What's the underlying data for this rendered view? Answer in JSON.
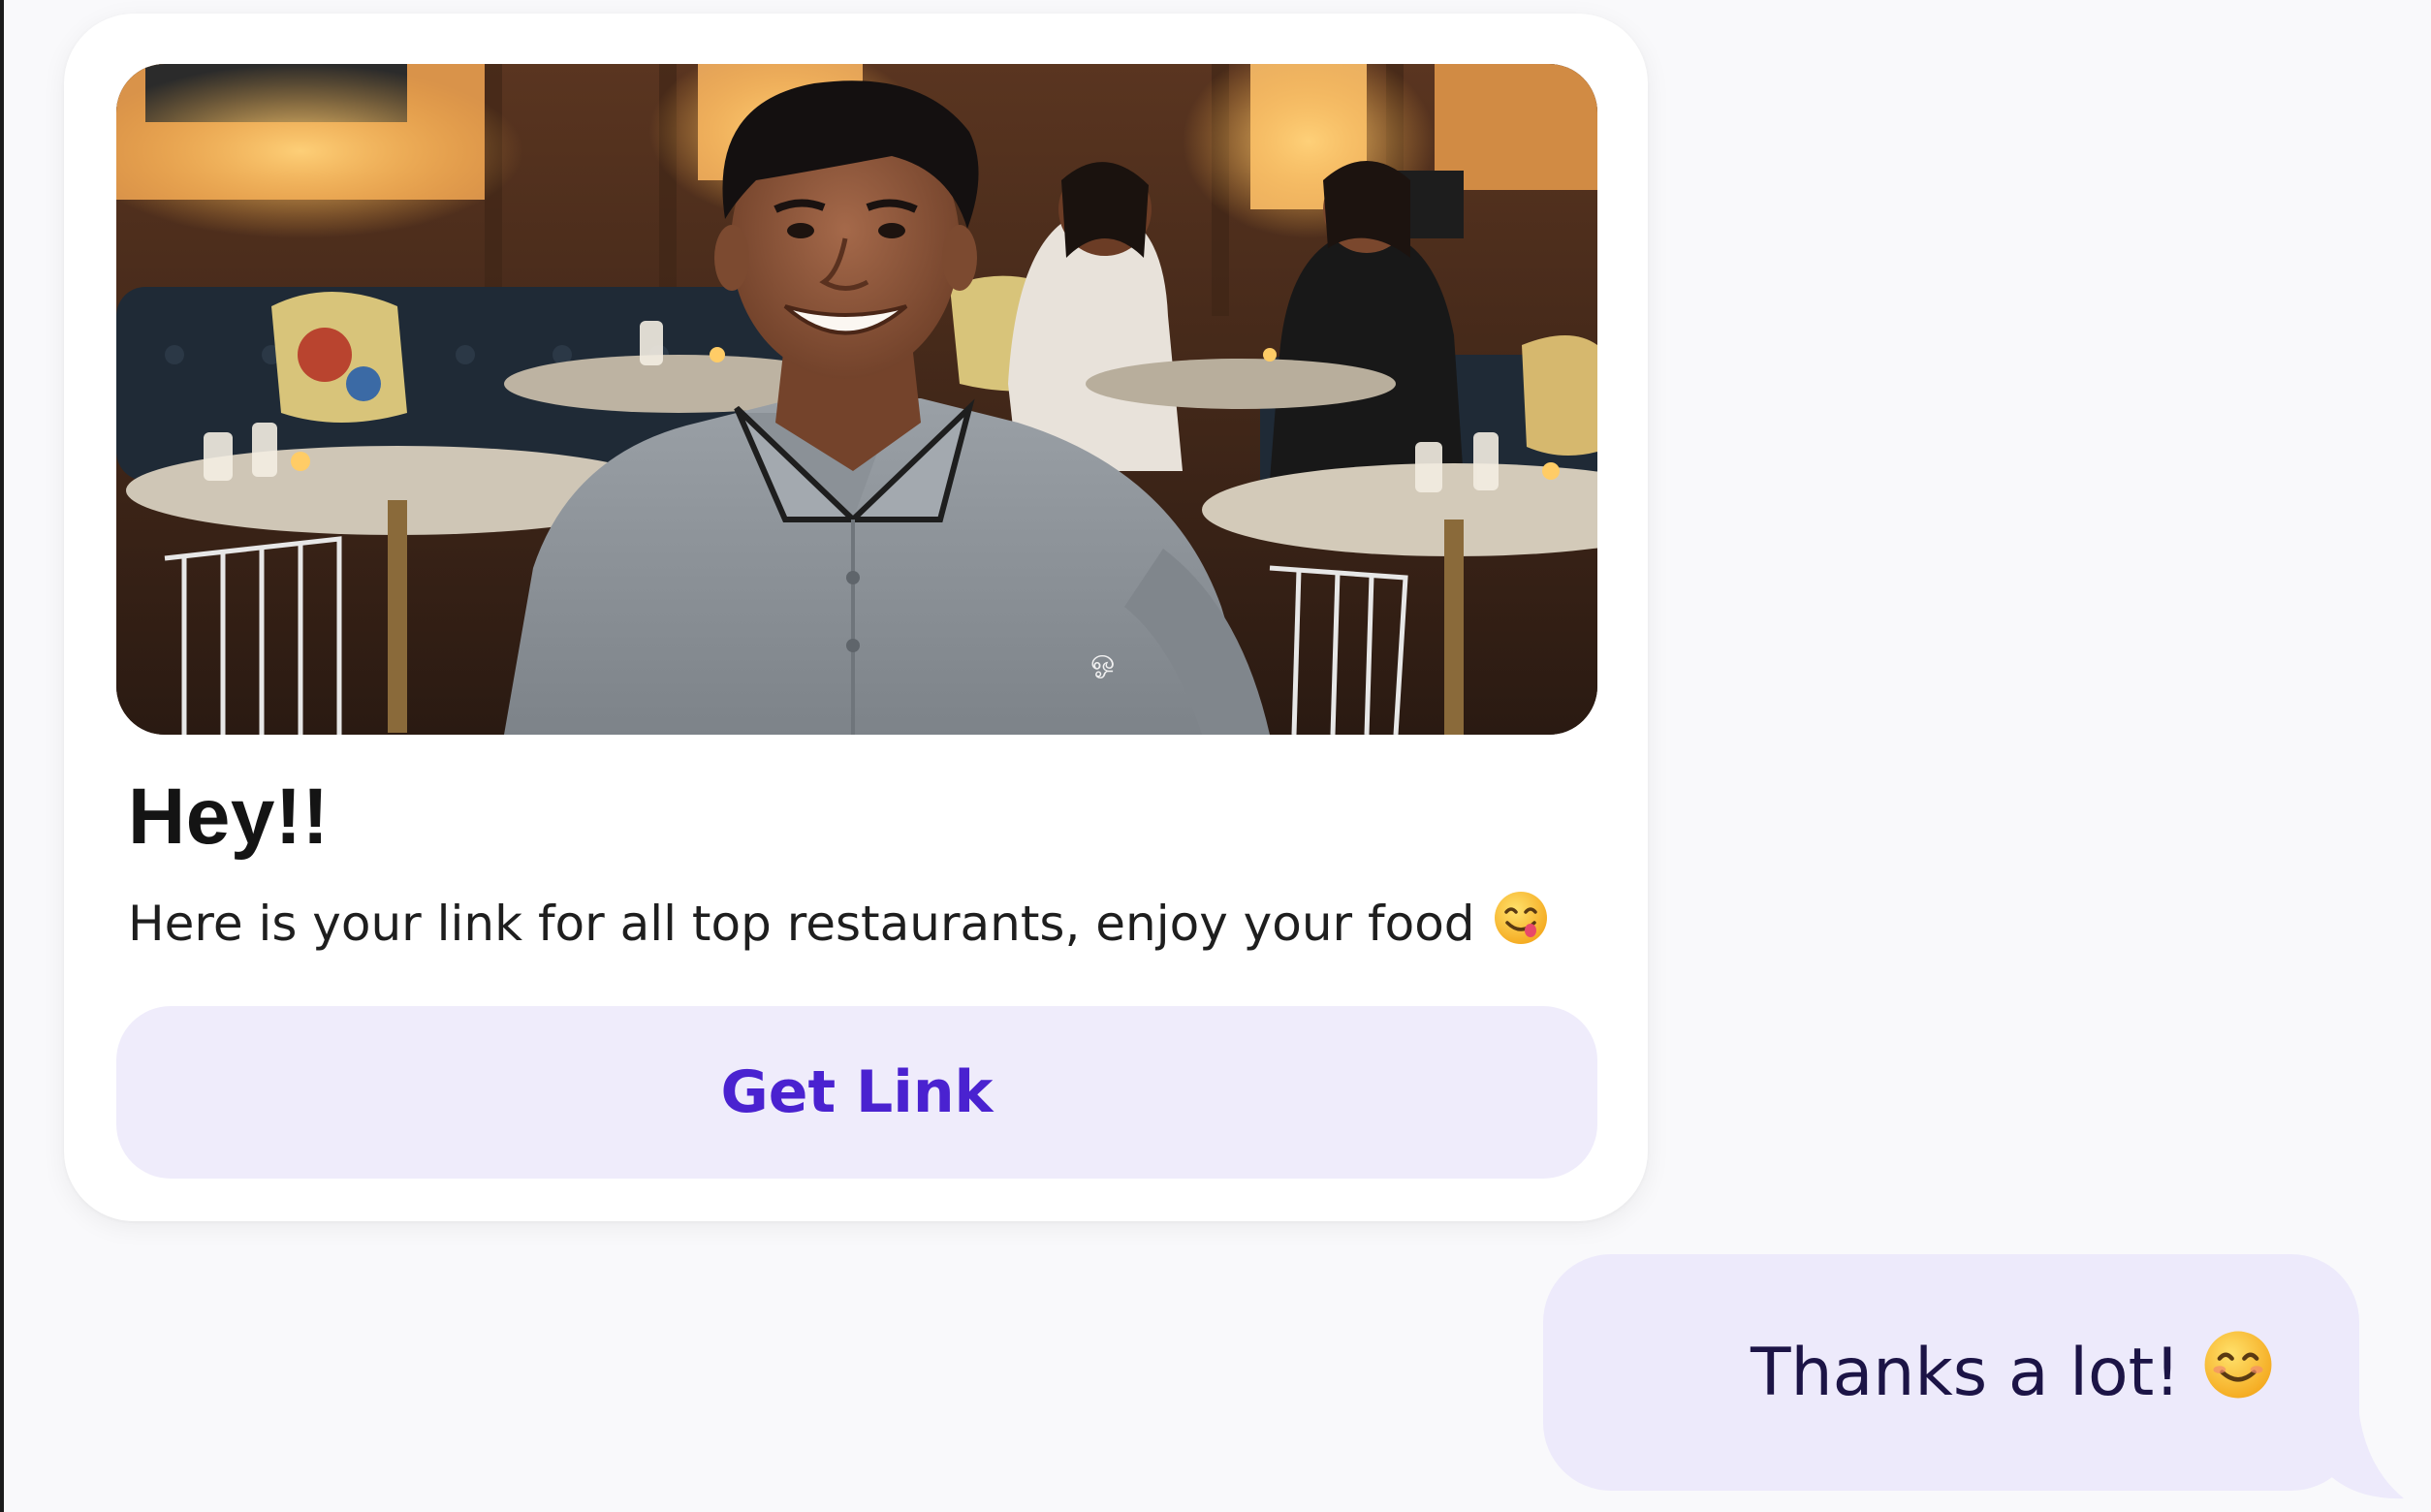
{
  "card": {
    "title": "Hey!!",
    "body": "Here is your link for all top restaurants, enjoy your food",
    "body_emoji": "face-savoring-food-icon",
    "button_label": "Get Link",
    "image": "photo-smiling-man-in-restaurant"
  },
  "reply": {
    "text": "Thanks a lot!",
    "emoji": "smiling-face-icon"
  },
  "colors": {
    "background": "#f9f9fb",
    "card": "#ffffff",
    "button_bg": "#efecfb",
    "button_text": "#4a22d0",
    "bubble_bg": "#edeafb",
    "bubble_text": "#1c1446"
  }
}
